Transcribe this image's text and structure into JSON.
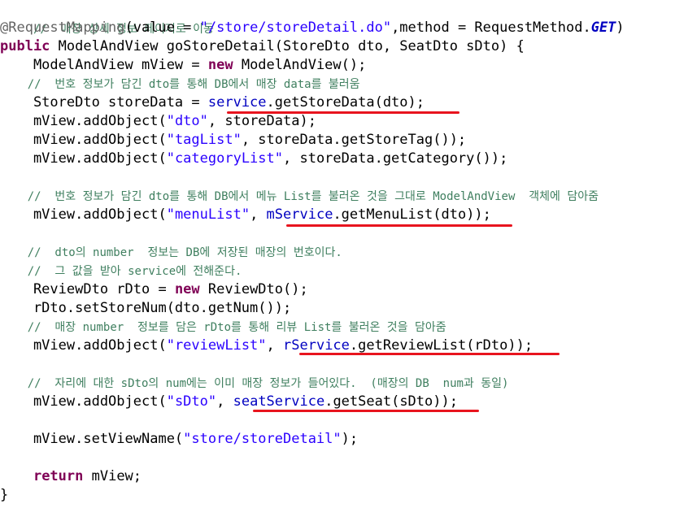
{
  "code": {
    "c1": "//  매장 상세 정보 페이지로 이동",
    "anno": "@RequestMapping",
    "anno_args_a": "(value = ",
    "anno_path": "\"/store/storeDetail.do\"",
    "anno_args_b": ",method = RequestMethod.",
    "anno_get": "GET",
    "anno_close": ")",
    "sig_kw": "public",
    "sig_rest": " ModelAndView goStoreDetail(StoreDto dto, SeatDto sDto) {",
    "l4": "    ModelAndView mView = ",
    "l4_new": "new",
    "l4_rest": " ModelAndView();",
    "c2": "    //  번호 정보가 담긴 dto를 통해 DB에서 매장 data를 불러움",
    "l6_a": "    StoreDto storeData = ",
    "l6_fld": "service",
    "l6_b": ".getStoreData(dto);",
    "l7_a": "    mView.addObject(",
    "l7_s": "\"dto\"",
    "l7_b": ", storeData);",
    "l8_s": "\"tagList\"",
    "l8_b": ", storeData.getStoreTag());",
    "l9_s": "\"categoryList\"",
    "l9_b": ", storeData.getCategory());",
    "c3": "    //  번호 정보가 담긴 dto를 통해 DB에서 메뉴 List를 불러온 것을 그대로 ModelAndView  객체에 담아줌",
    "l12_s": "\"menuList\"",
    "l12_fld": "mService",
    "l12_b": ".getMenuList(dto));",
    "c4": "    //  dto의 number  정보는 DB에 저장된 매장의 번호이다.",
    "c5": "    //  그 값을 받아 service에 전해준다.",
    "l16_a": "    ReviewDto rDto = ",
    "l16_new": "new",
    "l16_b": " ReviewDto();",
    "l17": "    rDto.setStoreNum(dto.getNum());",
    "c6": "    //  매장 number  정보를 담은 rDto를 통해 리뷰 List를 불러온 것을 담아줌",
    "l19_s": "\"reviewList\"",
    "l19_fld": "rService",
    "l19_b": ".getReviewList(rDto));",
    "c7": "    //  자리에 대한 sDto의 num에는 이미 매장 정보가 들어있다.  (매장의 DB  num과 동일)",
    "l22_s": "\"sDto\"",
    "l22_fld": "seatService",
    "l22_b": ".getSeat(sDto));",
    "l24_a": "    mView.setViewName(",
    "l24_s": "\"store/storeDetail\"",
    "l24_b": ");",
    "l26_kw": "return",
    "l26_b": " mView;",
    "l27": "}",
    "sep": ", "
  },
  "colors": {
    "comment": "#3f7f5f",
    "keyword": "#7f0055",
    "string": "#2a00ff",
    "field": "#0000c0",
    "annotation": "#646464",
    "underline": "#e8141e"
  }
}
